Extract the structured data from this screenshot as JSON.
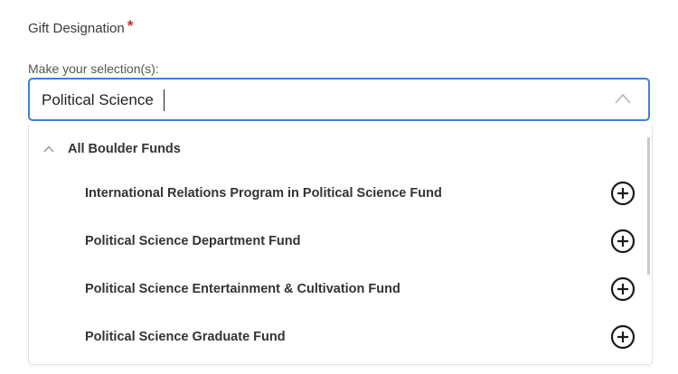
{
  "field": {
    "label": "Gift Designation",
    "required_mark": "*",
    "hint": "Make your selection(s):"
  },
  "search": {
    "value": "Political Science"
  },
  "dropdown": {
    "group_label": "All Boulder Funds",
    "options": [
      {
        "label": "International Relations Program in Political Science Fund"
      },
      {
        "label": "Political Science Department Fund"
      },
      {
        "label": "Political Science Entertainment & Cultivation Fund"
      },
      {
        "label": "Political Science Graduate Fund"
      }
    ]
  },
  "icons": {
    "collapse": "chevron-up-icon",
    "add": "plus-circle-icon"
  },
  "colors": {
    "focus_border": "#3b82d6",
    "required": "#d8262c"
  }
}
